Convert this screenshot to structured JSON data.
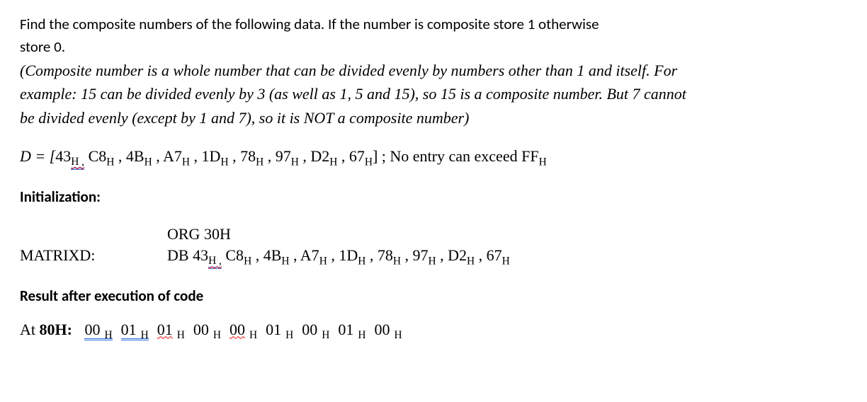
{
  "problem": {
    "line1": "Find the composite numbers of the following data. If the number is composite store 1 otherwise",
    "line2": "store 0.",
    "def1": "(Composite number is a whole number that can be divided evenly by numbers other than 1 and itself. For",
    "def2": "example: 15 can be divided evenly by 3 (as well as 1, 5 and 15), so 15 is a composite number. But 7 cannot",
    "def3": "be divided evenly (except by 1 and 7), so it is NOT a composite number)"
  },
  "arrayD": {
    "prefix": "D = [",
    "items": [
      "43",
      "C8",
      "4B",
      "A7",
      "1D",
      "78",
      "97",
      "D2",
      "67"
    ],
    "hexSuffix": "H",
    "close": "] ;",
    "note": "No entry can exceed FF"
  },
  "sections": {
    "initLabel": "Initialization:",
    "org": "ORG 30H",
    "matrixLabel": "MATRIXD:",
    "db": "DB",
    "resultLabel": "Result after execution of code",
    "atLabel": "At 80H:"
  },
  "result": {
    "values": [
      "00",
      "01",
      "01",
      "00",
      "00",
      "01",
      "00",
      "01",
      "00"
    ],
    "wavy": [
      false,
      false,
      true,
      false,
      true,
      false,
      false,
      false,
      false
    ],
    "dbl": [
      true,
      true,
      false,
      false,
      false,
      false,
      false,
      false,
      false
    ]
  }
}
